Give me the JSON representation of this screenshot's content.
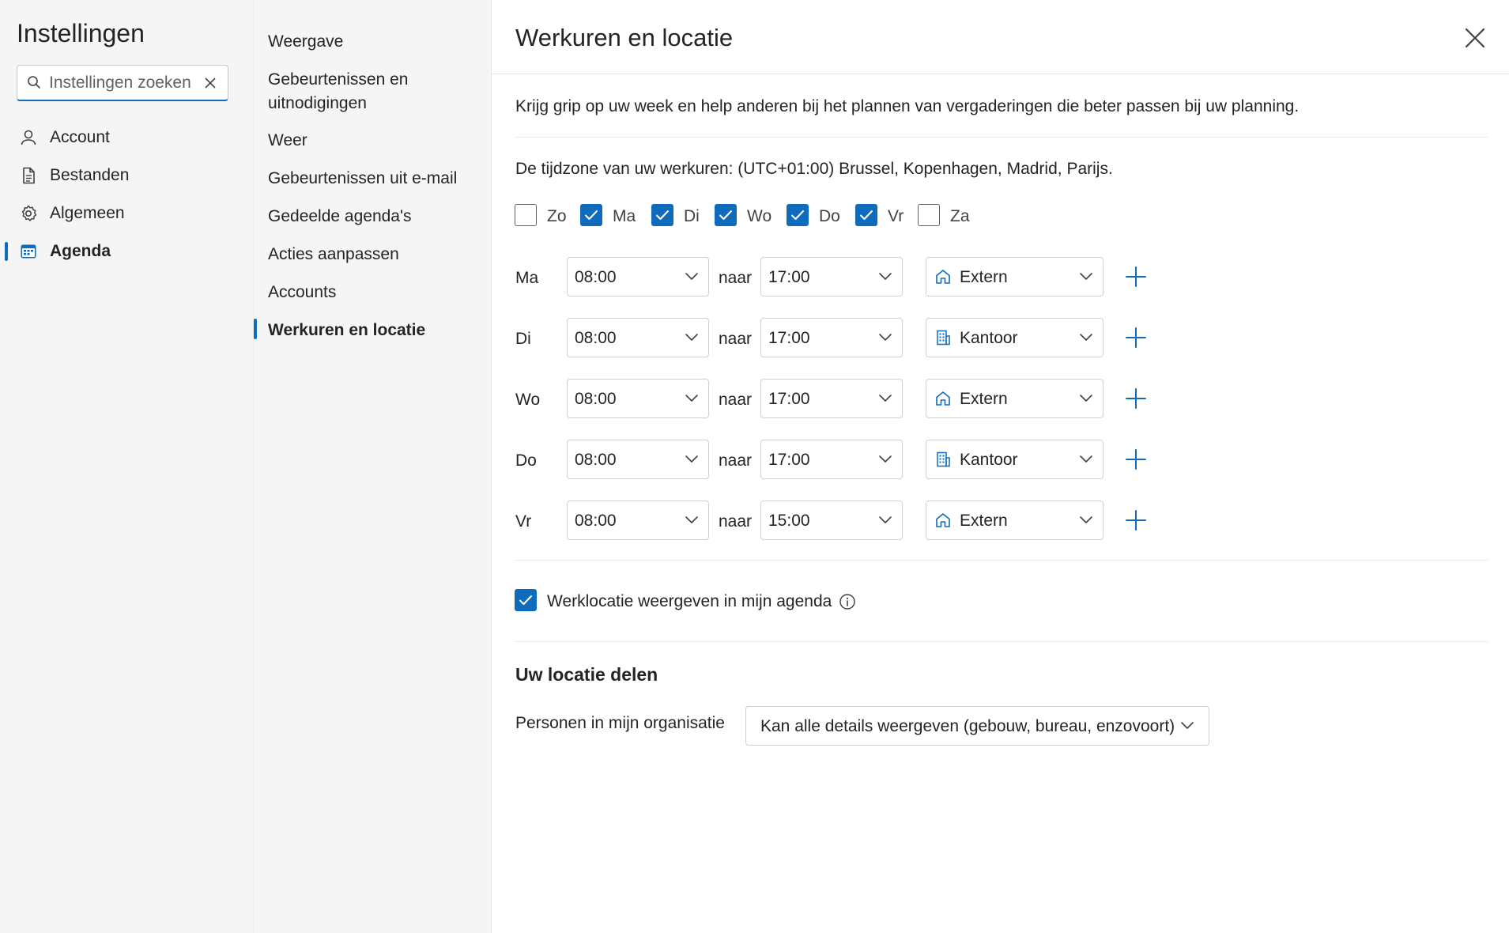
{
  "settings": {
    "title": "Instellingen",
    "search_placeholder": "Instellingen zoeken"
  },
  "nav_primary": [
    {
      "label": "Account",
      "icon": "person-icon"
    },
    {
      "label": "Bestanden",
      "icon": "document-icon"
    },
    {
      "label": "Algemeen",
      "icon": "gear-icon"
    },
    {
      "label": "Agenda",
      "icon": "calendar-icon",
      "active": true
    }
  ],
  "nav_secondary": [
    {
      "label": "Weergave"
    },
    {
      "label": "Gebeurtenissen en uitnodigingen"
    },
    {
      "label": "Weer"
    },
    {
      "label": "Gebeurtenissen uit e-mail"
    },
    {
      "label": "Gedeelde agenda's"
    },
    {
      "label": "Acties aanpassen"
    },
    {
      "label": "Accounts"
    },
    {
      "label": "Werkuren en locatie",
      "active": true
    }
  ],
  "main": {
    "title": "Werkuren en locatie",
    "intro": "Krijg grip op uw week en help anderen bij het plannen van vergaderingen die beter passen bij uw planning.",
    "timezone": "De tijdzone van uw werkuren: (UTC+01:00) Brussel, Kopenhagen, Madrid, Parijs.",
    "days": [
      {
        "label": "Zo",
        "checked": false
      },
      {
        "label": "Ma",
        "checked": true
      },
      {
        "label": "Di",
        "checked": true
      },
      {
        "label": "Wo",
        "checked": true
      },
      {
        "label": "Do",
        "checked": true
      },
      {
        "label": "Vr",
        "checked": true
      },
      {
        "label": "Za",
        "checked": false
      }
    ],
    "to_label": "naar",
    "schedule": [
      {
        "day": "Ma",
        "start": "08:00",
        "end": "17:00",
        "location": "Extern",
        "location_icon": "home-icon"
      },
      {
        "day": "Di",
        "start": "08:00",
        "end": "17:00",
        "location": "Kantoor",
        "location_icon": "building-icon"
      },
      {
        "day": "Wo",
        "start": "08:00",
        "end": "17:00",
        "location": "Extern",
        "location_icon": "home-icon"
      },
      {
        "day": "Do",
        "start": "08:00",
        "end": "17:00",
        "location": "Kantoor",
        "location_icon": "building-icon"
      },
      {
        "day": "Vr",
        "start": "08:00",
        "end": "15:00",
        "location": "Extern",
        "location_icon": "home-icon"
      }
    ],
    "show_location": {
      "label": "Werklocatie weergeven in mijn agenda",
      "checked": true
    },
    "share_heading": "Uw locatie delen",
    "share_label": "Personen in mijn organisatie",
    "share_value": "Kan alle details weergeven (gebouw, bureau, enzovoort)"
  },
  "colors": {
    "accent": "#0f6cbd",
    "pane_bg": "#f5f5f5",
    "text": "#242424"
  }
}
